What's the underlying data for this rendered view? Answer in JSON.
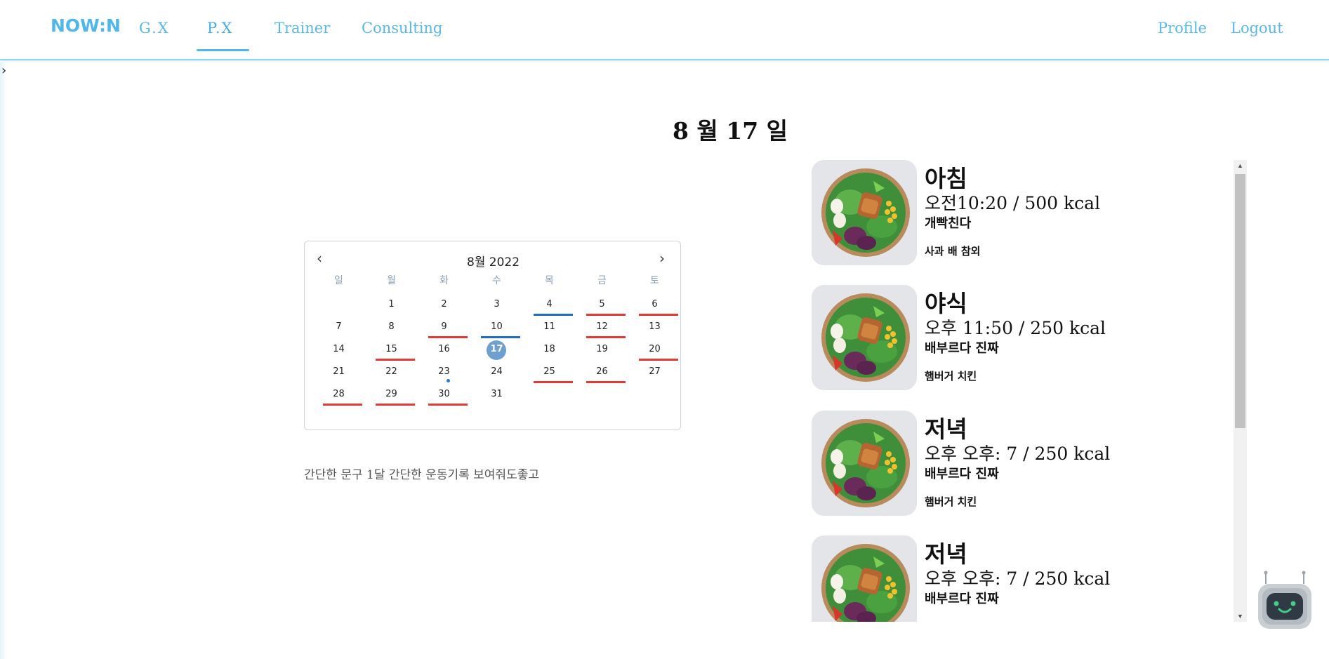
{
  "header": {
    "brand": "NOW:N",
    "nav": {
      "gx": "G.X",
      "px": "P.X",
      "trainer": "Trainer",
      "consulting": "Consulting",
      "profile": "Profile",
      "logout": "Logout"
    },
    "active_tab": "P.X"
  },
  "sidebar_toggle": "›",
  "date_title": "8 월 17 일",
  "calendar": {
    "title": "8월 2022",
    "prev_icon": "‹",
    "next_icon": "›",
    "weekdays": [
      "일",
      "월",
      "화",
      "수",
      "목",
      "금",
      "토"
    ],
    "selected_day": "17",
    "weeks": [
      [
        {
          "d": ""
        },
        {
          "d": "1"
        },
        {
          "d": "2"
        },
        {
          "d": "3"
        },
        {
          "d": "4",
          "mark": "blue"
        },
        {
          "d": "5",
          "mark": "red"
        },
        {
          "d": "6",
          "mark": "red"
        }
      ],
      [
        {
          "d": "7"
        },
        {
          "d": "8"
        },
        {
          "d": "9",
          "mark": "red"
        },
        {
          "d": "10",
          "mark": "blue"
        },
        {
          "d": "11"
        },
        {
          "d": "12",
          "mark": "red"
        },
        {
          "d": "13"
        }
      ],
      [
        {
          "d": "14"
        },
        {
          "d": "15",
          "mark": "red"
        },
        {
          "d": "16"
        },
        {
          "d": "17",
          "selected": true
        },
        {
          "d": "18"
        },
        {
          "d": "19"
        },
        {
          "d": "20",
          "mark": "red"
        }
      ],
      [
        {
          "d": "21"
        },
        {
          "d": "22"
        },
        {
          "d": "23",
          "dot": true
        },
        {
          "d": "24"
        },
        {
          "d": "25",
          "mark": "red"
        },
        {
          "d": "26",
          "mark": "red"
        },
        {
          "d": "27"
        }
      ],
      [
        {
          "d": "28",
          "mark": "red"
        },
        {
          "d": "29",
          "mark": "red"
        },
        {
          "d": "30",
          "mark": "red"
        },
        {
          "d": "31"
        },
        {
          "d": ""
        },
        {
          "d": ""
        },
        {
          "d": ""
        }
      ]
    ],
    "colors": {
      "red_mark": "#e53935",
      "blue_mark": "#1e6fc2",
      "selected": "#6e9fd1"
    }
  },
  "caption": "간단한 문구 1달 간단한 운동기록 보여줘도좋고",
  "meals": [
    {
      "name": "아침",
      "time": "오전10:20 / 500 kcal",
      "memo": "개빡친다",
      "foods": "사과 배 참외"
    },
    {
      "name": "야식",
      "time": "오후 11:50 / 250 kcal",
      "memo": "배부르다 진짜",
      "foods": "햄버거 치킨"
    },
    {
      "name": "저녁",
      "time": "오후 오후: 7 / 250 kcal",
      "memo": "배부르다 진짜",
      "foods": "햄버거 치킨"
    },
    {
      "name": "저녁",
      "time": "오후 오후: 7 / 250 kcal",
      "memo": "배부르다 진짜",
      "foods": ""
    }
  ],
  "icons": {
    "meal_image": "salad-bowl-icon",
    "robot": "robot-assistant-icon"
  },
  "theme": {
    "accent": "#4fb8ea"
  }
}
